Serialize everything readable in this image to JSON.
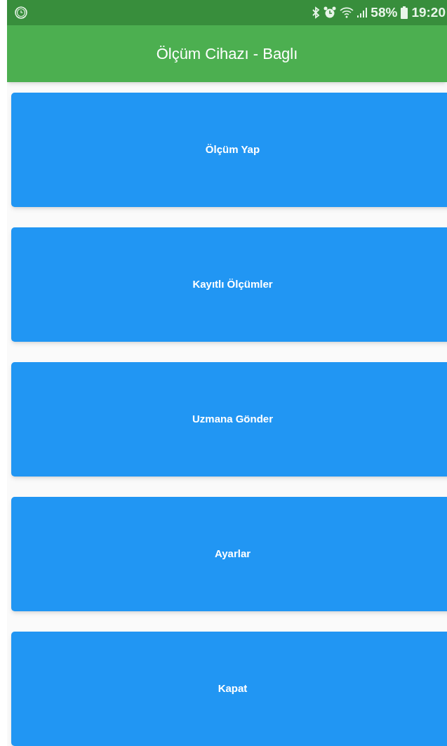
{
  "status_bar": {
    "battery": "58%",
    "time": "19:20"
  },
  "app_bar": {
    "title": "Ölçüm Cihazı - Baglı"
  },
  "buttons": [
    {
      "label": "Ölçüm Yap"
    },
    {
      "label": "Kayıtlı Ölçümler"
    },
    {
      "label": "Uzmana Gönder"
    },
    {
      "label": "Ayarlar"
    },
    {
      "label": "Kapat"
    }
  ]
}
